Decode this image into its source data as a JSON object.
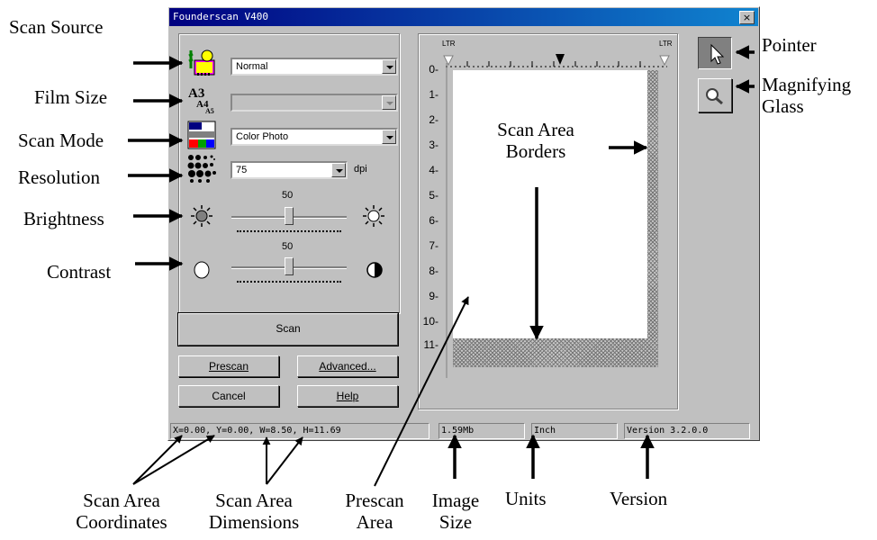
{
  "window": {
    "title": "Founderscan V400",
    "close_label": "×"
  },
  "controls": {
    "scan_source_value": "Normal",
    "film_size_value": "",
    "film_size_icon_text": "A3",
    "scan_mode_value": "Color Photo",
    "resolution_value": "75",
    "resolution_unit": "dpi",
    "brightness_value": 0.5,
    "brightness_label": "50",
    "contrast_value": 0.5,
    "contrast_label": "50"
  },
  "buttons": {
    "scan": "Scan",
    "prescan": "Prescan",
    "advanced": "Advanced...",
    "cancel": "Cancel",
    "help": "Help"
  },
  "ruler": {
    "top_left_label": "LTR",
    "top_right_label": "LTR",
    "marks": [
      "0-",
      "1-",
      "2-",
      "3-",
      "4-",
      "5-",
      "6-",
      "7-",
      "8-",
      "9-",
      "10-",
      "11-"
    ]
  },
  "status_bar": {
    "coords": "X=0.00, Y=0.00, W=8.50, H=11.69",
    "image_size": "1.59Mb",
    "units": "Inch",
    "version": "Version 3.2.0.0"
  },
  "callouts": {
    "scan_source": "Scan Source",
    "film_size": "Film Size",
    "scan_mode": "Scan Mode",
    "resolution": "Resolution",
    "brightness": "Brightness",
    "contrast": "Contrast",
    "pointer": "Pointer",
    "magnifying_glass": "Magnifying Glass",
    "scan_area_borders": "Scan Area Borders",
    "scan_area_coordinates": "Scan Area Coordinates",
    "scan_area_dimensions": "Scan Area Dimensions",
    "prescan_area": "Prescan Area",
    "image_size": "Image Size",
    "units": "Units",
    "version": "Version"
  },
  "colors": {
    "title_bar": "#000080",
    "window_face": "#c0c0c0",
    "scan_area": "#ffffff"
  },
  "icons": [
    "scan-source-icon",
    "film-size-icon",
    "scan-mode-icon",
    "resolution-icon",
    "brightness-low-icon",
    "brightness-high-icon",
    "contrast-low-icon",
    "contrast-high-icon",
    "pointer-tool-icon",
    "magnifier-tool-icon"
  ]
}
